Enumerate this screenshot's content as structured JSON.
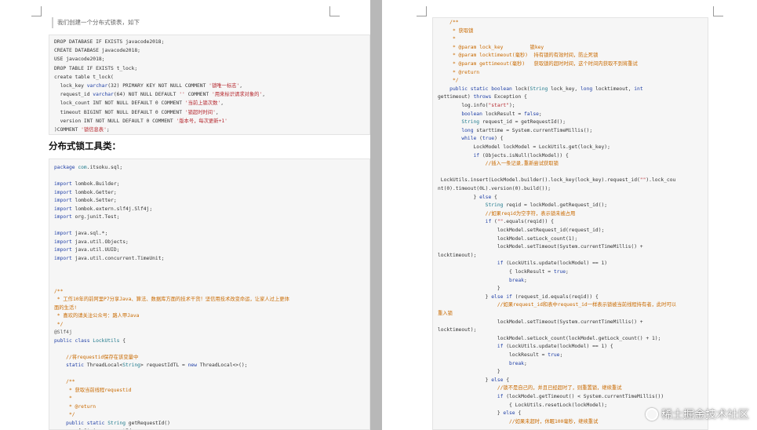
{
  "left_page": {
    "intro": "我们创建一个分布式锁表，如下",
    "sql_lines": [
      [
        [
          "",
          "DROP DATABASE IF EXISTS javacode2018;"
        ]
      ],
      [
        [
          "",
          "CREATE DATABASE javacode2018;"
        ]
      ],
      [
        [
          "",
          "USE javacode2018;"
        ]
      ],
      [
        [
          "",
          "DROP TABLE IF EXISTS t_lock;"
        ]
      ],
      [
        [
          "",
          "create table t_lock("
        ]
      ],
      [
        [
          "",
          "  lock_key "
        ],
        [
          "kw",
          "varchar"
        ],
        [
          "",
          "(32) PRIMARY KEY NOT NULL COMMENT "
        ],
        [
          "st",
          "'锁唯一标志'"
        ],
        [
          "",
          ","
        ]
      ],
      [
        [
          "",
          "  request_id "
        ],
        [
          "kw",
          "varchar"
        ],
        [
          "",
          "(64) NOT NULL DEFAULT "
        ],
        [
          "st",
          "''"
        ],
        [
          "",
          " COMMENT "
        ],
        [
          "st",
          "'用来标识请求对象的'"
        ],
        [
          "",
          ","
        ]
      ],
      [
        [
          "",
          "  lock_count INT NOT NULL DEFAULT 0 COMMENT "
        ],
        [
          "st",
          "'当前上锁次数'"
        ],
        [
          "",
          ","
        ]
      ],
      [
        [
          "",
          "  timeout BIGINT NOT NULL DEFAULT 0 COMMENT "
        ],
        [
          "st",
          "'锁超时时间'"
        ],
        [
          "",
          ","
        ]
      ],
      [
        [
          "",
          "  version INT NOT NULL DEFAULT 0 COMMENT "
        ],
        [
          "st",
          "'版本号，每次更新+1'"
        ]
      ],
      [
        [
          "",
          ")COMMENT "
        ],
        [
          "st",
          "'锁信息表'"
        ],
        [
          "",
          ";"
        ]
      ]
    ],
    "heading": "分布式锁工具类：",
    "java_lines": [
      [
        [
          "kw",
          "package"
        ],
        [
          "",
          " "
        ],
        [
          "ty",
          "com"
        ],
        [
          "",
          ".itsoku.sql;"
        ]
      ],
      [
        [
          "",
          ""
        ]
      ],
      [
        [
          "kw",
          "import"
        ],
        [
          "",
          " lombok.Builder;"
        ]
      ],
      [
        [
          "kw",
          "import"
        ],
        [
          "",
          " lombok.Getter;"
        ]
      ],
      [
        [
          "kw",
          "import"
        ],
        [
          "",
          " lombok.Setter;"
        ]
      ],
      [
        [
          "kw",
          "import"
        ],
        [
          "",
          " lombok.extern.slf4j.Slf4j;"
        ]
      ],
      [
        [
          "kw",
          "import"
        ],
        [
          "",
          " org.junit.Test;"
        ]
      ],
      [
        [
          "",
          ""
        ]
      ],
      [
        [
          "kw",
          "import"
        ],
        [
          "",
          " java.sql.*;"
        ]
      ],
      [
        [
          "kw",
          "import"
        ],
        [
          "",
          " java.util.Objects;"
        ]
      ],
      [
        [
          "kw",
          "import"
        ],
        [
          "",
          " java.util.UUID;"
        ]
      ],
      [
        [
          "kw",
          "import"
        ],
        [
          "",
          " java.util.concurrent.TimeUnit;"
        ]
      ],
      [
        [
          "",
          ""
        ]
      ],
      [
        [
          "",
          ""
        ]
      ],
      [
        [
          "",
          ""
        ]
      ],
      [
        [
          "cm",
          "/**"
        ]
      ],
      [
        [
          "cm",
          " * 工作10年的前阿里P7分享Java、算法、数据库方面的技术干货！坚信用技术改变命运，让家人过上更体"
        ]
      ],
      [
        [
          "cm",
          "面的生活!"
        ]
      ],
      [
        [
          "cm",
          " * 喜欢的请关注公众号：路人甲Java"
        ]
      ],
      [
        [
          "cm",
          " */"
        ]
      ],
      [
        [
          "ann",
          "@Slf4j"
        ]
      ],
      [
        [
          "kw",
          "public class"
        ],
        [
          "",
          " "
        ],
        [
          "ty",
          "LockUtils"
        ],
        [
          "",
          " {"
        ]
      ],
      [
        [
          "",
          ""
        ]
      ],
      [
        [
          "cm",
          "    //将requestid保存在该变量中"
        ]
      ],
      [
        [
          "kw",
          "    static"
        ],
        [
          "",
          " ThreadLocal<"
        ],
        [
          "ty",
          "String"
        ],
        [
          "",
          "> requestIdTL = "
        ],
        [
          "kw",
          "new"
        ],
        [
          "",
          " ThreadLocal<>();"
        ]
      ],
      [
        [
          "",
          ""
        ]
      ],
      [
        [
          "cm",
          "    /**"
        ]
      ],
      [
        [
          "cm",
          "     * 获取当前线程requestid"
        ]
      ],
      [
        [
          "cm",
          "     *"
        ]
      ],
      [
        [
          "cm",
          "     * @return"
        ]
      ],
      [
        [
          "cm",
          "     */"
        ]
      ],
      [
        [
          "kw",
          "    public static"
        ],
        [
          "",
          " "
        ],
        [
          "ty",
          "String"
        ],
        [
          "",
          " getRequestId()"
        ]
      ],
      [
        [
          "",
          "        { String requestId ="
        ]
      ]
    ]
  },
  "right_page": {
    "code_lines": [
      [
        [
          "cm",
          "    /**"
        ]
      ],
      [
        [
          "cm",
          "     * 获取锁"
        ]
      ],
      [
        [
          "cm",
          "     *"
        ]
      ],
      [
        [
          "cm",
          "     * @param lock_key         锁key"
        ]
      ],
      [
        [
          "cm",
          "     * @param locktimeout(毫秒)  持有锁的有效时间，防止死锁"
        ]
      ],
      [
        [
          "cm",
          "     * @param gettimeout(毫秒)   获取锁的超时时间，这个时间内获取不到将重试"
        ]
      ],
      [
        [
          "cm",
          "     * @return"
        ]
      ],
      [
        [
          "cm",
          "     */"
        ]
      ],
      [
        [
          "kw",
          "    public static boolean"
        ],
        [
          "",
          " lock("
        ],
        [
          "ty",
          "String"
        ],
        [
          "",
          " lock_key, "
        ],
        [
          "kw",
          "long"
        ],
        [
          "",
          " locktimeout, "
        ],
        [
          "kw",
          "int"
        ]
      ],
      [
        [
          "",
          "gettimeout) "
        ],
        [
          "kw",
          "throws"
        ],
        [
          "",
          " Exception {"
        ]
      ],
      [
        [
          "",
          "        log.info("
        ],
        [
          "st",
          "\"start\""
        ],
        [
          "",
          ");"
        ]
      ],
      [
        [
          "kw",
          "        boolean"
        ],
        [
          "",
          " lockResult = "
        ],
        [
          "kw",
          "false"
        ],
        [
          "",
          ";"
        ]
      ],
      [
        [
          "ty",
          "        String"
        ],
        [
          "",
          " request_id = getRequestId();"
        ]
      ],
      [
        [
          "kw",
          "        long"
        ],
        [
          "",
          " starttime = System.currentTimeMillis();"
        ]
      ],
      [
        [
          "kw",
          "        while"
        ],
        [
          "",
          " ("
        ],
        [
          "kw",
          "true"
        ],
        [
          "",
          ") {"
        ]
      ],
      [
        [
          "",
          "            LockModel lockModel = LockUtils.get(lock_key);"
        ]
      ],
      [
        [
          "kw",
          "            if"
        ],
        [
          "",
          " (Objects.isNull(lockModel)) {"
        ]
      ],
      [
        [
          "cm",
          "                //插入一条记录,重新尝试获取锁"
        ]
      ],
      [
        [
          "",
          ""
        ]
      ],
      [
        [
          "",
          " LockUtils.insert(LockModel.builder().lock_key(lock_key).request_id("
        ],
        [
          "st",
          "\"\""
        ],
        [
          "",
          ").lock_cou"
        ]
      ],
      [
        [
          "",
          "nt(0).timeout(0L).version(0).build());"
        ]
      ],
      [
        [
          "",
          "            } "
        ],
        [
          "kw",
          "else"
        ],
        [
          "",
          " {"
        ]
      ],
      [
        [
          "ty",
          "                String"
        ],
        [
          "",
          " reqid = lockModel.getRequest_id();"
        ]
      ],
      [
        [
          "cm",
          "                //如果reqid为空字符，表示锁未被占用"
        ]
      ],
      [
        [
          "kw",
          "                if"
        ],
        [
          "",
          " ("
        ],
        [
          "st",
          "\"\""
        ],
        [
          "",
          ".equals(reqid)) {"
        ]
      ],
      [
        [
          "",
          "                    lockModel.setRequest_id(request_id);"
        ]
      ],
      [
        [
          "",
          "                    lockModel.setLock_count(1);"
        ]
      ],
      [
        [
          "",
          "                    lockModel.setTimeout(System.currentTimeMillis() +"
        ]
      ],
      [
        [
          "",
          "locktimeout);"
        ]
      ],
      [
        [
          "kw",
          "                    if"
        ],
        [
          "",
          " (LockUtils.update(lockModel) == 1)"
        ]
      ],
      [
        [
          "",
          "                        { lockResult = "
        ],
        [
          "kw",
          "true"
        ],
        [
          "",
          ";"
        ]
      ],
      [
        [
          "kw",
          "                        break"
        ],
        [
          "",
          ";"
        ]
      ],
      [
        [
          "",
          "                    }"
        ]
      ],
      [
        [
          "",
          "                } "
        ],
        [
          "kw",
          "else if"
        ],
        [
          "",
          " (request_id.equals(reqid)) {"
        ]
      ],
      [
        [
          "cm",
          "                    //如果request_id和表中request_id一样表示锁被当前线程持有者，此时可以"
        ]
      ],
      [
        [
          "cm",
          "重入锁"
        ]
      ],
      [
        [
          "",
          "                    lockModel.setTimeout(System.currentTimeMillis() +"
        ]
      ],
      [
        [
          "",
          "locktimeout);"
        ]
      ],
      [
        [
          "",
          "                    lockModel.setLock_count(lockModel.getLock_count() + 1);"
        ]
      ],
      [
        [
          "kw",
          "                    if"
        ],
        [
          "",
          " (LockUtils.update(lockModel) == 1) {"
        ]
      ],
      [
        [
          "",
          "                        lockResult = "
        ],
        [
          "kw",
          "true"
        ],
        [
          "",
          ";"
        ]
      ],
      [
        [
          "kw",
          "                        break"
        ],
        [
          "",
          ";"
        ]
      ],
      [
        [
          "",
          "                    }"
        ]
      ],
      [
        [
          "",
          "                } "
        ],
        [
          "kw",
          "else"
        ],
        [
          "",
          " {"
        ]
      ],
      [
        [
          "cm",
          "                    //锁不是自己的，并且已经超时了，则重置锁，继续重试"
        ]
      ],
      [
        [
          "kw",
          "                    if"
        ],
        [
          "",
          " (lockModel.getTimeout() < System.currentTimeMillis())"
        ]
      ],
      [
        [
          "",
          "                        { LockUtils.resetLock(lockModel);"
        ]
      ],
      [
        [
          "",
          "                    } "
        ],
        [
          "kw",
          "else"
        ],
        [
          "",
          " {"
        ]
      ],
      [
        [
          "cm",
          "                        //如果未超时，休眠100毫秒，继续重试"
        ]
      ]
    ]
  },
  "watermark": "稀土掘金技术社区"
}
